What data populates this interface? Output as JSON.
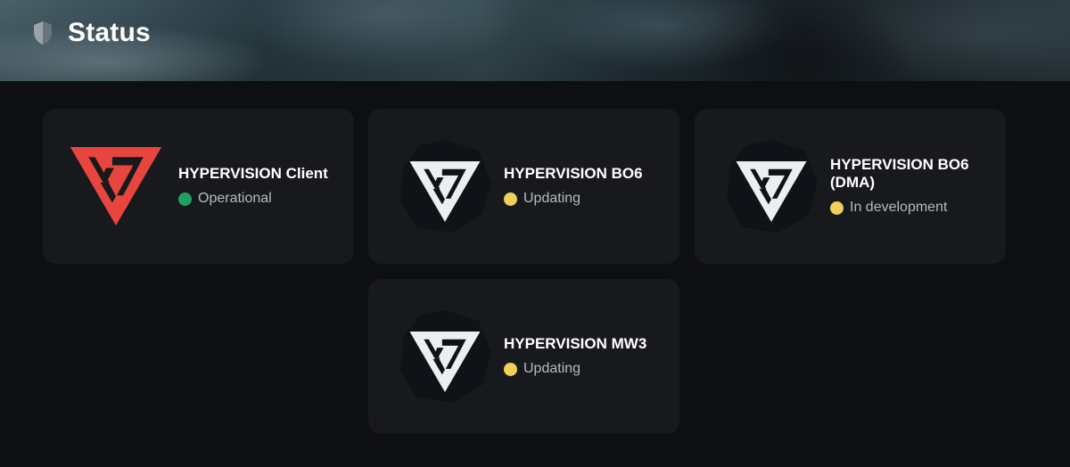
{
  "header": {
    "title": "Status",
    "icon": "shield-icon"
  },
  "colors": {
    "operational": "#22a060",
    "updating": "#f0cf5a",
    "in_development": "#f0cf5a",
    "brand_red": "#e8453f"
  },
  "cards": [
    {
      "name": "HYPERVISION Client",
      "status": "Operational",
      "status_color": "#22a060",
      "logo": "hypervision-red-logo"
    },
    {
      "name": "HYPERVISION BO6",
      "status": "Updating",
      "status_color": "#f0cf5a",
      "logo": "hypervision-white-logo"
    },
    {
      "name": "HYPERVISION BO6 (DMA)",
      "status": "In development",
      "status_color": "#f0cf5a",
      "logo": "hypervision-white-logo"
    },
    {
      "name": "HYPERVISION MW3",
      "status": "Updating",
      "status_color": "#f0cf5a",
      "logo": "hypervision-white-logo"
    }
  ]
}
